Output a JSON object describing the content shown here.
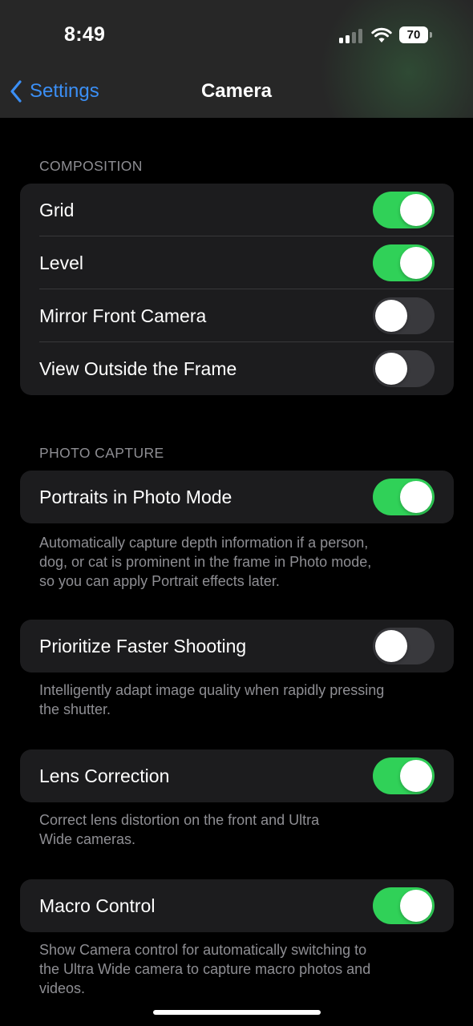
{
  "status_bar": {
    "time": "8:49",
    "battery": "70",
    "icons": [
      "cellular-signal-icon",
      "wifi-icon",
      "battery-icon"
    ]
  },
  "nav": {
    "back_label": "Settings",
    "title": "Camera"
  },
  "composition": {
    "header": "COMPOSITION",
    "rows": [
      {
        "label": "Grid",
        "on": true
      },
      {
        "label": "Level",
        "on": true
      },
      {
        "label": "Mirror Front Camera",
        "on": false
      },
      {
        "label": "View Outside the Frame",
        "on": false
      }
    ]
  },
  "photo_capture": {
    "header": "PHOTO CAPTURE",
    "portraits": {
      "label": "Portraits in Photo Mode",
      "on": true,
      "footnote": [
        "Automatically capture depth information if a person,",
        "dog, or cat is prominent in the frame in Photo mode,",
        "so you can apply Portrait effects later."
      ]
    }
  },
  "faster_shooting": {
    "label": "Prioritize Faster Shooting",
    "on": false,
    "footnote": [
      "Intelligently adapt image quality when rapidly pressing",
      "the shutter."
    ]
  },
  "lens_correction": {
    "label": "Lens Correction",
    "on": true,
    "footnote": [
      "Correct lens distortion on the front and Ultra",
      "Wide cameras."
    ]
  },
  "macro_control": {
    "label": "Macro Control",
    "on": true,
    "footnote": [
      "Show Camera control for automatically switching to",
      "the Ultra Wide camera to capture macro photos and",
      "videos."
    ]
  },
  "colors": {
    "toggle_on": "#30d158",
    "toggle_off": "#39393d",
    "accent": "#3b8ff5",
    "background": "#000000",
    "group_background": "#1c1c1e",
    "secondary_text": "#8e8e93"
  }
}
